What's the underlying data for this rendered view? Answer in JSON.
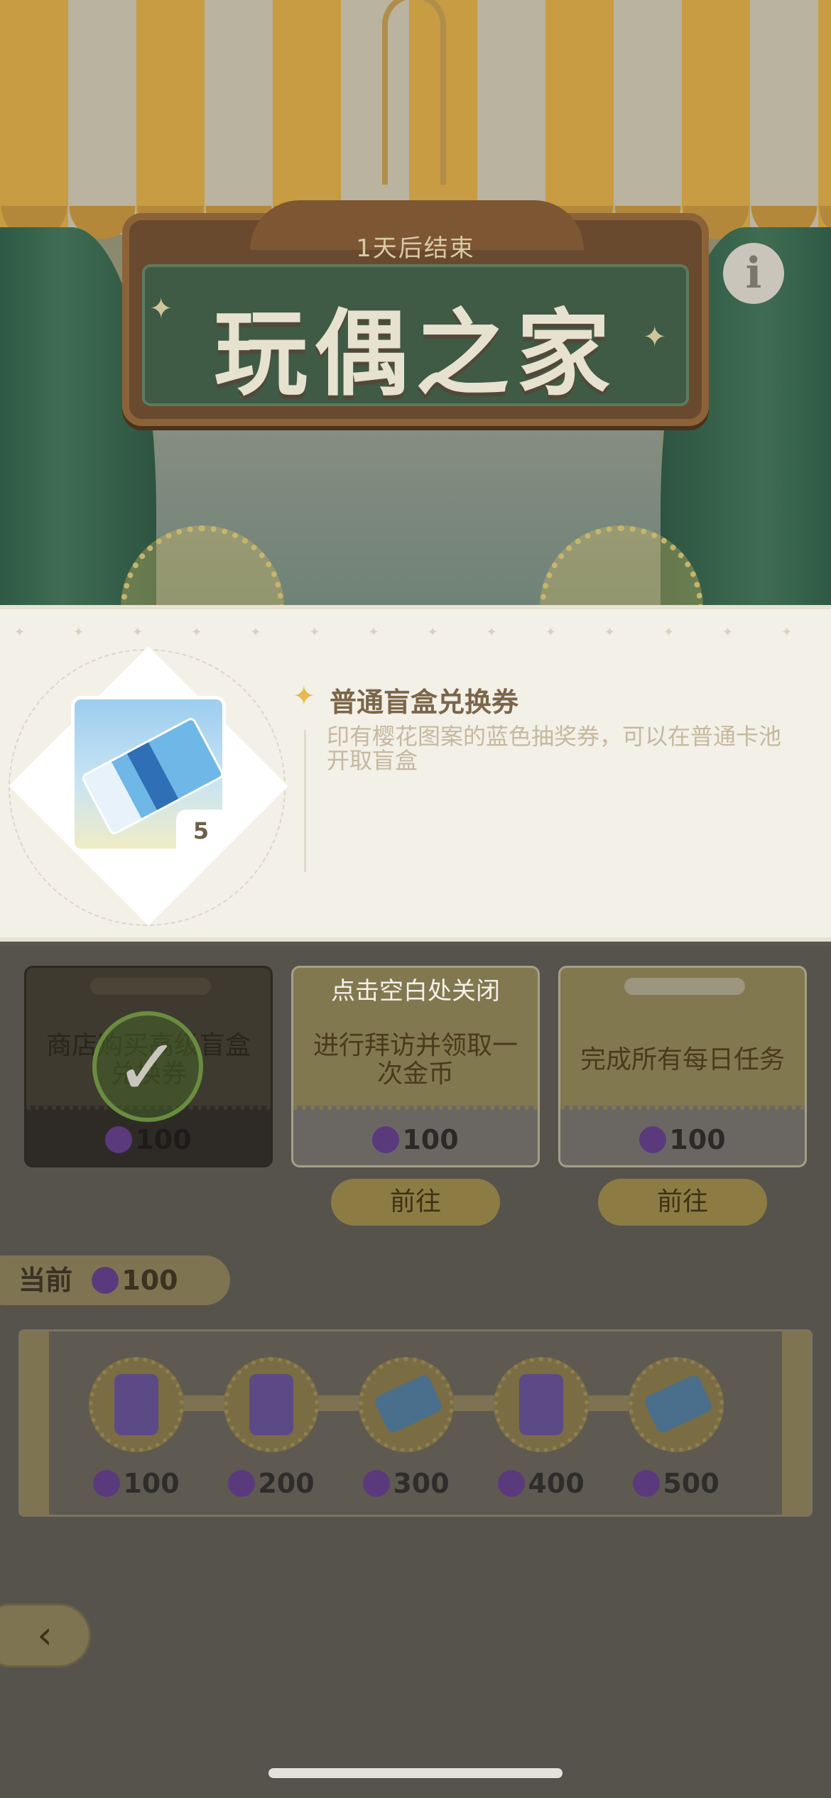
{
  "header": {
    "ends_in": "1天后结束",
    "title": "玩偶之家",
    "info_icon": "info-icon"
  },
  "item": {
    "name": "普通盲盒兑换券",
    "description": "印有樱花图案的蓝色抽奖券，可以在普通卡池开取盲盒",
    "quantity": "5"
  },
  "overlay": {
    "close_hint": "点击空白处关闭"
  },
  "tasks": [
    {
      "text": "商店购买高级盲盒兑换券",
      "reward": "100",
      "completed": true
    },
    {
      "text": "进行拜访并领取一次金币",
      "reward": "100",
      "completed": false,
      "button": "前往"
    },
    {
      "text": "完成所有每日任务",
      "reward": "100",
      "completed": false,
      "button": "前往"
    }
  ],
  "progress": {
    "current_label": "当前",
    "current_value": "100",
    "milestones": [
      {
        "value": "100",
        "reward_icon": "hourglass-icon"
      },
      {
        "value": "200",
        "reward_icon": "hourglass-icon"
      },
      {
        "value": "300",
        "reward_icon": "ticket-icon"
      },
      {
        "value": "400",
        "reward_icon": "hourglass-icon"
      },
      {
        "value": "500",
        "reward_icon": "ticket-icon"
      }
    ]
  },
  "colors": {
    "accent_gold": "#c79c42",
    "panel_bg": "#f3f0e8",
    "moon_purple": "#5a3a7d"
  }
}
